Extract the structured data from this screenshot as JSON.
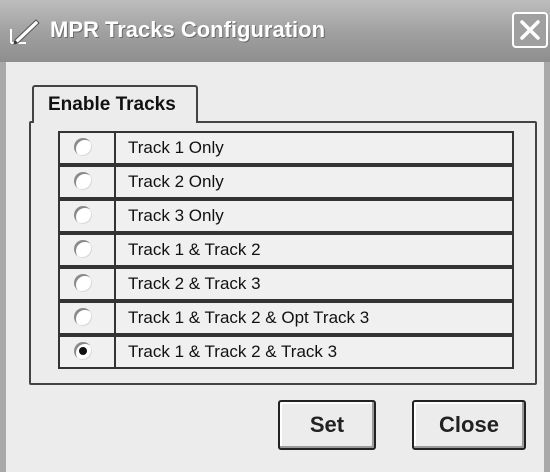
{
  "window": {
    "title": "MPR Tracks Configuration",
    "title_bar_color": "#9e9e9e",
    "app_icon": "edit-pencil-icon",
    "close_icon": "close-x-icon"
  },
  "tab": {
    "label": "Enable Tracks"
  },
  "options": [
    {
      "label": "Track 1 Only",
      "selected": false
    },
    {
      "label": "Track 2 Only",
      "selected": false
    },
    {
      "label": "Track 3 Only",
      "selected": false
    },
    {
      "label": "Track 1 & Track 2",
      "selected": false
    },
    {
      "label": "Track 2 & Track 3",
      "selected": false
    },
    {
      "label": "Track 1 & Track 2 & Opt Track 3",
      "selected": false
    },
    {
      "label": "Track 1 & Track 2 & Track 3",
      "selected": true
    }
  ],
  "buttons": {
    "set_label": "Set",
    "close_label": "Close"
  }
}
